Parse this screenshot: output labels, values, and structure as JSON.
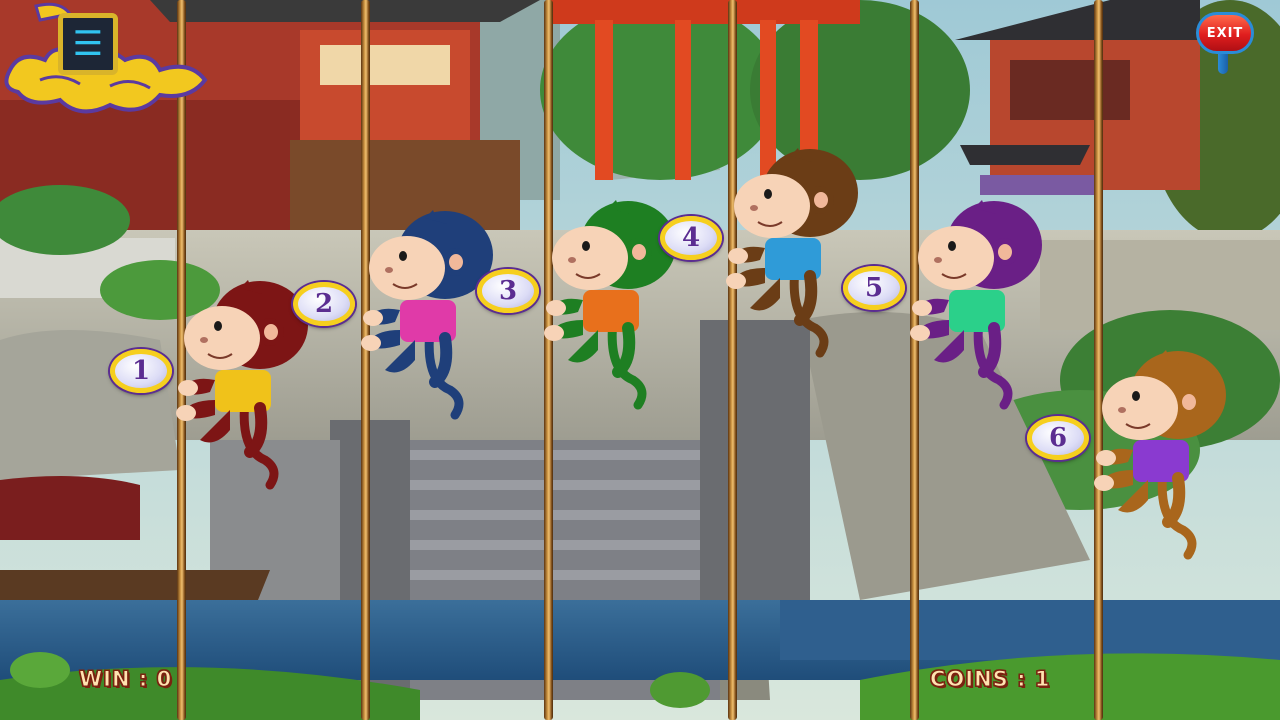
{
  "hud": {
    "win_label": "WIN : 0",
    "coins_label": "COINS : 1"
  },
  "exit_button": {
    "label": "EXIT"
  },
  "menu_button": {
    "icon": "bars-icon",
    "glyph": "☰"
  },
  "monkeys": [
    {
      "number": "1",
      "fur": "#7d1515",
      "shirt": "#f0c21a"
    },
    {
      "number": "2",
      "fur": "#1f3f7a",
      "shirt": "#e03aa8"
    },
    {
      "number": "3",
      "fur": "#1e7f22",
      "shirt": "#e8701c"
    },
    {
      "number": "4",
      "fur": "#6b3d16",
      "shirt": "#2f9bd8"
    },
    {
      "number": "5",
      "fur": "#6a1f86",
      "shirt": "#2bd08a"
    },
    {
      "number": "6",
      "fur": "#a9661c",
      "shirt": "#8a3ad0"
    }
  ],
  "colors": {
    "badge_border": "#f6cf1e",
    "badge_text": "#5b2d91",
    "hud_text": "#ffe3b0",
    "exit_red": "#e01e1e"
  }
}
